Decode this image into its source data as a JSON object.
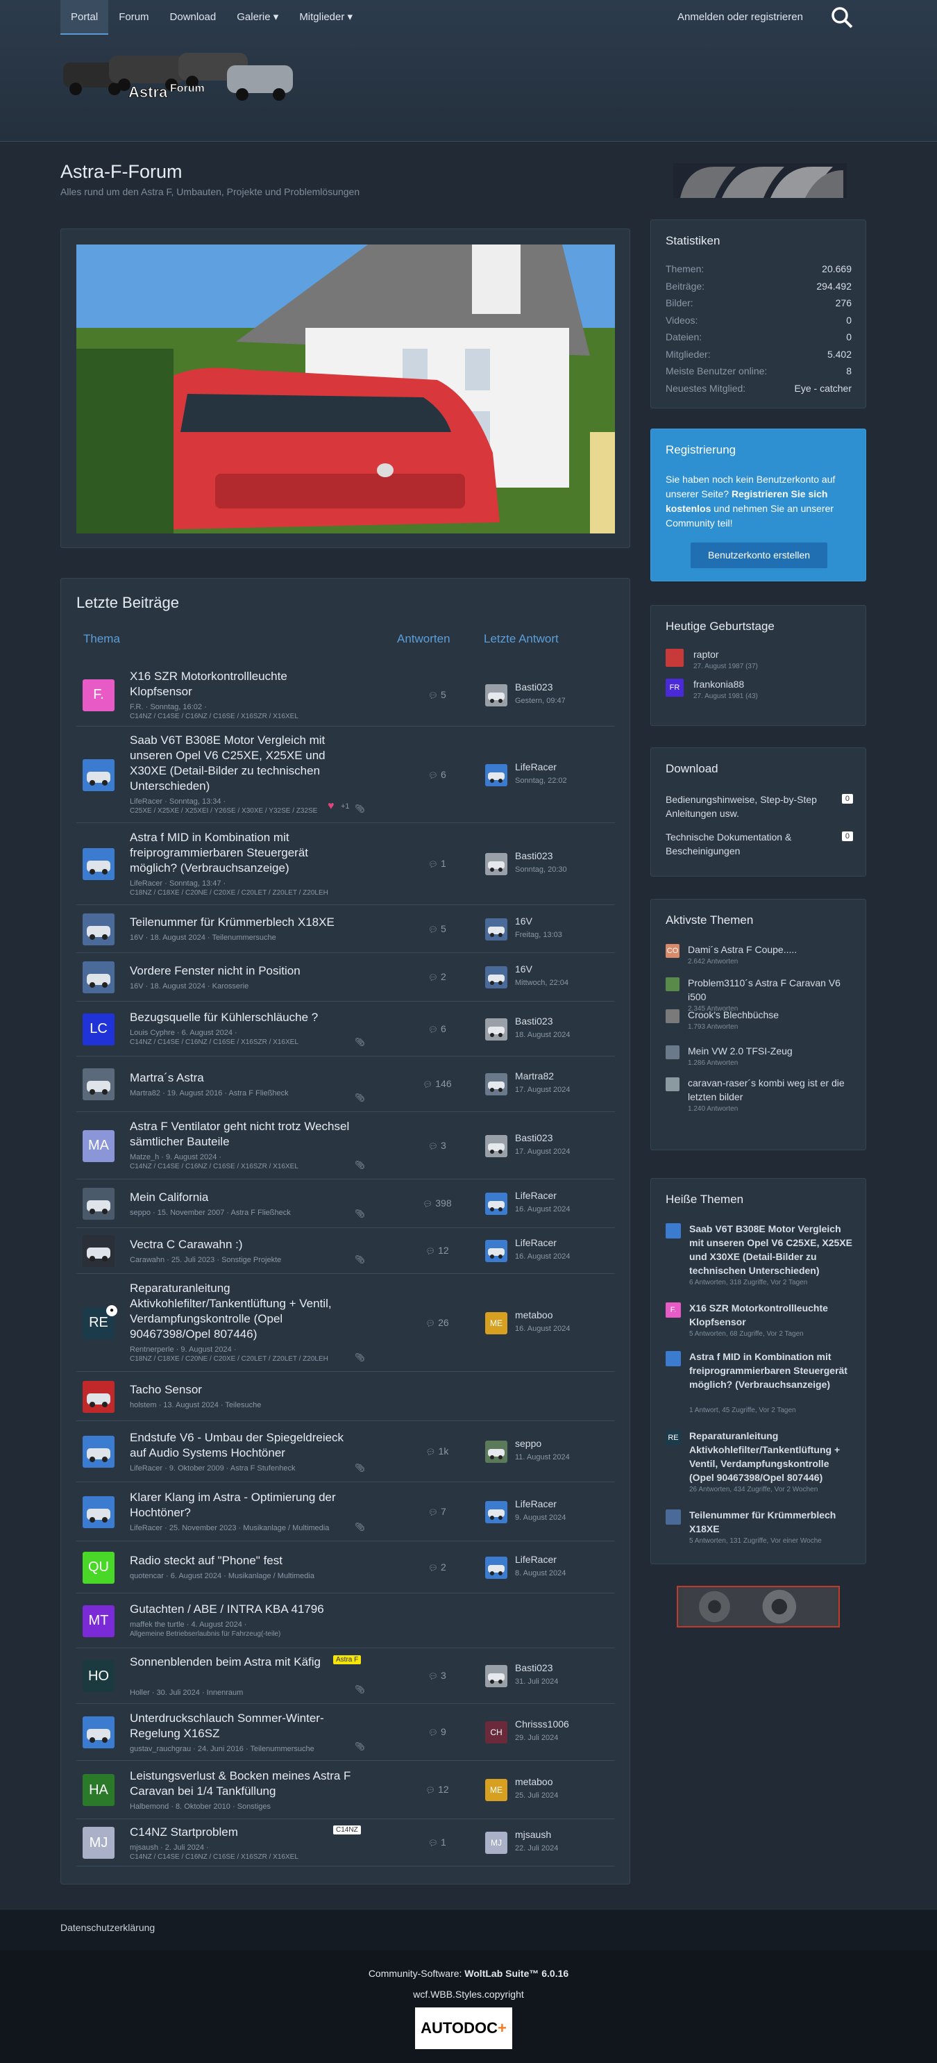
{
  "nav": {
    "items": [
      "Portal",
      "Forum",
      "Download",
      "Galerie",
      "Mitglieder"
    ],
    "login": "Anmelden oder registrieren"
  },
  "site": {
    "title": "Astra-F-Forum",
    "subtitle": "Alles rund um den Astra F, Umbauten, Projekte und Problemlösungen"
  },
  "posts": {
    "heading": "Letzte Beiträge",
    "col_topic": "Thema",
    "col_replies": "Antworten",
    "col_last": "Letzte Antwort",
    "rows": [
      {
        "avatar": "F.",
        "avcolor": "#e85bc6",
        "title": "X16 SZR Motorkontrollleuchte Klopfsensor",
        "meta": "F.R. · Sonntag, 16:02 ·",
        "tags": "C14NZ / C14SE / C16NZ / C16SE / X16SZR / X16XEL",
        "replies": "5",
        "last": "Basti023",
        "time": "Gestern, 09:47"
      },
      {
        "avatar": "",
        "avcolor": "#3b7bd0",
        "title": "Saab V6T B308E Motor Vergleich mit unseren Opel V6 C25XE, X25XE und X30XE (Detail-Bilder zu technischen Unterschieden)",
        "meta": "LifeRacer · Sonntag, 13:34 ·",
        "tags": "C25XE / X25XE / X25XEI / Y26SE / X30XE / Y32SE / Z32SE",
        "replies": "6",
        "last": "LifeRacer",
        "time": "Sonntag, 22:02",
        "likes": "+1"
      },
      {
        "avatar": "",
        "avcolor": "#3b7bd0",
        "title": "Astra f MID in Kombination mit freiprogrammierbaren Steuergerät möglich? (Verbrauchsanzeige)",
        "meta": "LifeRacer · Sonntag, 13:47 ·",
        "tags": "C18NZ / C18XE / C20NE / C20XE / C20LET / Z20LET / Z20LEH",
        "replies": "1",
        "last": "Basti023",
        "time": "Sonntag, 20:30"
      },
      {
        "avatar": "",
        "avcolor": "#4a6a9a",
        "title": "Teilenummer für Krümmerblech X18XE",
        "meta": "16V · 18. August 2024 · Teilenummersuche",
        "tags": "",
        "replies": "5",
        "last": "16V",
        "time": "Freitag, 13:03"
      },
      {
        "avatar": "",
        "avcolor": "#4a6a9a",
        "title": "Vordere Fenster nicht in Position",
        "meta": "16V · 18. August 2024 · Karosserie",
        "tags": "",
        "replies": "2",
        "last": "16V",
        "time": "Mittwoch, 22:04"
      },
      {
        "avatar": "LC",
        "avcolor": "#2033d8",
        "title": "Bezugsquelle für Kühlerschläuche ?",
        "meta": "Louis Cyphre · 6. August 2024 ·",
        "tags": "C14NZ / C14SE / C16NZ / C16SE / X16SZR / X16XEL",
        "replies": "6",
        "last": "Basti023",
        "time": "18. August 2024"
      },
      {
        "avatar": "",
        "avcolor": "#5a6a7a",
        "title": "Martra´s Astra",
        "meta": "Martra82 · 19. August 2016 · Astra F Fließheck",
        "tags": "",
        "replies": "146",
        "last": "Martra82",
        "time": "17. August 2024"
      },
      {
        "avatar": "MA",
        "avcolor": "#8a96d8",
        "title": "Astra F Ventilator geht nicht trotz Wechsel sämtlicher Bauteile",
        "meta": "Matze_h · 9. August 2024 ·",
        "tags": "C14NZ / C14SE / C16NZ / C16SE / X16SZR / X16XEL",
        "replies": "3",
        "last": "Basti023",
        "time": "17. August 2024"
      },
      {
        "avatar": "",
        "avcolor": "#4a5a6a",
        "title": "Mein California",
        "meta": "seppo · 15. November 2007 · Astra F Fließheck",
        "tags": "",
        "replies": "398",
        "last": "LifeRacer",
        "time": "16. August 2024"
      },
      {
        "avatar": "",
        "avcolor": "#2a2f38",
        "title": "Vectra C Carawahn :)",
        "meta": "Carawahn · 25. Juli 2023 · Sonstige Projekte",
        "tags": "",
        "replies": "12",
        "last": "LifeRacer",
        "time": "16. August 2024"
      },
      {
        "avatar": "RE",
        "avcolor": "#1b3a4a",
        "title": "Reparaturanleitung Aktivkohlefilter/Tankentlüftung + Ventil, Verdampfungskontrolle (Opel 90467398/Opel 807446)",
        "meta": "Rentnerperle · 9. August 2024 ·",
        "tags": "C18NZ / C18XE / C20NE / C20XE / C20LET / Z20LET / Z20LEH",
        "replies": "26",
        "last": "metaboo",
        "time": "16. August 2024"
      },
      {
        "avatar": "",
        "avcolor": "#c0282a",
        "title": "Tacho Sensor",
        "meta": "holstem · 13. August 2024 · Teilesuche",
        "tags": "",
        "replies": "",
        "last": "",
        "time": ""
      },
      {
        "avatar": "",
        "avcolor": "#3b7bd0",
        "title": "Endstufe V6 - Umbau der Spiegeldreieck auf Audio Systems Hochtöner",
        "meta": "LifeRacer · 9. Oktober 2009 · Astra F Stufenheck",
        "tags": "",
        "replies": "1k",
        "last": "seppo",
        "time": "11. August 2024"
      },
      {
        "avatar": "",
        "avcolor": "#3b7bd0",
        "title": "Klarer Klang im Astra - Optimierung der Hochtöner?",
        "meta": "LifeRacer · 25. November 2023 · Musikanlage / Multimedia",
        "tags": "",
        "replies": "7",
        "last": "LifeRacer",
        "time": "9. August 2024"
      },
      {
        "avatar": "QU",
        "avcolor": "#4ad828",
        "title": "Radio steckt auf \"Phone\" fest",
        "meta": "quotencar · 6. August 2024 · Musikanlage / Multimedia",
        "tags": "",
        "replies": "2",
        "last": "LifeRacer",
        "time": "8. August 2024"
      },
      {
        "avatar": "MT",
        "avcolor": "#7b2ad8",
        "title": "Gutachten / ABE / INTRA KBA 41796",
        "meta": "maffek the turtle · 4. August 2024 ·",
        "tags": "Allgemeine Betriebserlaubnis für Fahrzeug(-teile)",
        "replies": "",
        "last": "",
        "time": ""
      },
      {
        "avatar": "HO",
        "avcolor": "#1a3a40",
        "title": "Sonnenblenden beim Astra mit Käfig",
        "meta": "Holler · 30. Juli 2024 · Innenraum",
        "tags": "",
        "replies": "3",
        "last": "Basti023",
        "time": "31. Juli 2024",
        "badge": "Astra F"
      },
      {
        "avatar": "",
        "avcolor": "#3b7bd0",
        "title": "Unterdruckschlauch Sommer-Winter-Regelung X16SZ",
        "meta": "gustav_rauchgrau · 24. Juni 2016 · Teilenummersuche",
        "tags": "",
        "replies": "9",
        "last": "Chrisss1006",
        "time": "29. Juli 2024"
      },
      {
        "avatar": "HA",
        "avcolor": "#2a7a2a",
        "title": "Leistungsverlust & Bocken meines Astra F Caravan bei 1/4 Tankfüllung",
        "meta": "Halbemond · 8. Oktober 2010 · Sonstiges",
        "tags": "",
        "replies": "12",
        "last": "metaboo",
        "time": "25. Juli 2024"
      },
      {
        "avatar": "MJ",
        "avcolor": "#aab0c8",
        "title": "C14NZ Startproblem",
        "meta": "mjsaush · 2. Juli 2024 ·",
        "tags": "C14NZ / C14SE / C16NZ / C16SE / X16SZR / X16XEL",
        "replies": "1",
        "last": "mjsaush",
        "time": "22. Juli 2024",
        "badge": "C14NZ"
      }
    ]
  },
  "stats": {
    "heading": "Statistiken",
    "items": [
      {
        "k": "Themen:",
        "v": "20.669"
      },
      {
        "k": "Beiträge:",
        "v": "294.492"
      },
      {
        "k": "Bilder:",
        "v": "276"
      },
      {
        "k": "Videos:",
        "v": "0"
      },
      {
        "k": "Dateien:",
        "v": "0"
      },
      {
        "k": "Mitglieder:",
        "v": "5.402"
      },
      {
        "k": "Meiste Benutzer online:",
        "v": "8"
      },
      {
        "k": "Neuestes Mitglied:",
        "v": "Eye - catcher"
      }
    ]
  },
  "registration": {
    "heading": "Registrierung",
    "text_a": "Sie haben noch kein Benutzerkonto auf unserer Seite? ",
    "text_b": "Registrieren Sie sich kostenlos",
    "text_c": " und nehmen Sie an unserer Community teil!",
    "button": "Benutzerkonto erstellen"
  },
  "birthdays": {
    "heading": "Heutige Geburtstage",
    "items": [
      {
        "name": "raptor",
        "sub": "27. August 1987 (37)"
      },
      {
        "name": "frankonia88",
        "sub": "27. August 1981 (43)",
        "av": "FR"
      }
    ]
  },
  "download": {
    "heading": "Download",
    "items": [
      {
        "name": "Bedienungshinweise, Step-by-Step Anleitungen usw.",
        "count": "0"
      },
      {
        "name": "Technische Dokumentation & Bescheinigungen",
        "count": "0"
      }
    ]
  },
  "active": {
    "heading": "Aktivste Themen",
    "items": [
      {
        "name": "Dami´s Astra F Coupe.....",
        "sub": "2.642 Antworten"
      },
      {
        "name": "Problem3110´s Astra F Caravan V6 i500",
        "sub": "2.345 Antworten"
      },
      {
        "name": "Crook's Blechbüchse",
        "sub": "1.793 Antworten"
      },
      {
        "name": "Mein VW 2.0 TFSI-Zeug",
        "sub": "1.286 Antworten"
      },
      {
        "name": "caravan-raser´s kombi weg ist er die letzten bilder",
        "sub": "1.240 Antworten"
      }
    ]
  },
  "hot": {
    "heading": "Heiße Themen",
    "items": [
      {
        "name": "Saab V6T B308E Motor Vergleich mit unseren Opel V6 C25XE, X25XE und X30XE (Detail-Bilder zu technischen Unterschieden)",
        "sub": "6 Antworten, 318 Zugriffe, Vor 2 Tagen"
      },
      {
        "name": "X16 SZR Motorkontrollleuchte Klopfsensor",
        "sub": "5 Antworten, 68 Zugriffe, Vor 2 Tagen",
        "av": "F."
      },
      {
        "name": "Astra f MID in Kombination mit freiprogrammierbaren Steuergerät möglich? (Verbrauchsanzeige)",
        "sub": "1 Antwort, 45 Zugriffe, Vor 2 Tagen"
      },
      {
        "name": "Reparaturanleitung Aktivkohlefilter/Tankentlüftung + Ventil, Verdampfungskontrolle (Opel 90467398/Opel 807446)",
        "sub": "26 Antworten, 434 Zugriffe, Vor 2 Wochen",
        "av": "RE"
      },
      {
        "name": "Teilenummer für Krümmerblech X18XE",
        "sub": "5 Antworten, 131 Zugriffe, Vor einer Woche"
      }
    ]
  },
  "footer": {
    "privacy": "Datenschutzerklärung",
    "copy_prefix": "Community-Software: ",
    "copy_brand": "WoltLab Suite™ 6.0.16",
    "copy2": "wcf.WBB.Styles.copyright",
    "autodoc": "AUTODOC"
  },
  "colors": {
    "accent": "#5b9fd8",
    "registration_bg": "#2e8fd1"
  }
}
